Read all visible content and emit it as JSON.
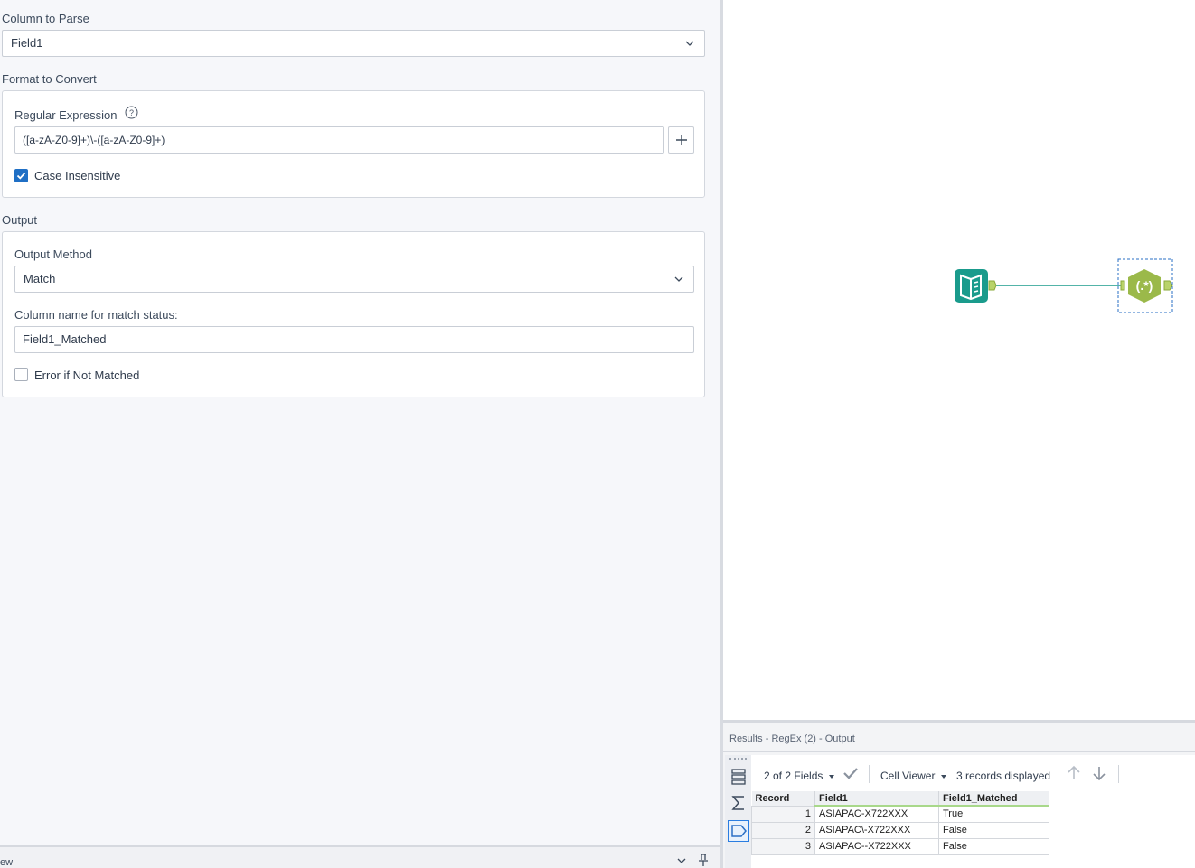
{
  "config": {
    "column_to_parse": {
      "label": "Column to Parse",
      "value": "Field1"
    },
    "format_to_convert": {
      "label": "Format to Convert",
      "regex_label": "Regular Expression",
      "regex_value": "([a-zA-Z0-9]+)\\-([a-zA-Z0-9]+)",
      "case_insensitive_label": "Case Insensitive",
      "case_insensitive_checked": true
    },
    "output": {
      "label": "Output",
      "method_label": "Output Method",
      "method_value": "Match",
      "match_col_label": "Column name for match status:",
      "match_col_value": "Field1_Matched",
      "error_label": "Error if Not Matched",
      "error_checked": false
    },
    "bottom_tab_text": "ew"
  },
  "canvas": {
    "regex_tool_glyph": "(.*)",
    "accent_green": "#9bb94a",
    "input_tool_color": "#1a9b8c"
  },
  "results": {
    "title": "Results - RegEx (2) - Output",
    "fields_selector": "2 of 2 Fields",
    "cell_viewer": "Cell Viewer",
    "records_displayed": "3 records displayed",
    "columns": [
      "Record",
      "Field1",
      "Field1_Matched"
    ],
    "rows": [
      {
        "record": "1",
        "field1": "ASIAPAC-X722XXX",
        "matched": "True"
      },
      {
        "record": "2",
        "field1": "ASIAPAC\\-X722XXX",
        "matched": "False"
      },
      {
        "record": "3",
        "field1": "ASIAPAC--X722XXX",
        "matched": "False"
      }
    ]
  }
}
